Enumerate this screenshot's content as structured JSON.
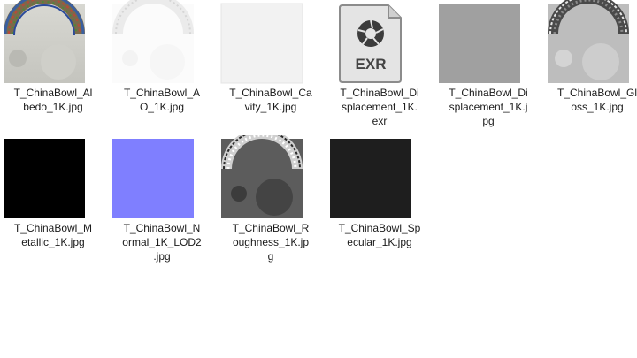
{
  "files": [
    {
      "name": "albedo",
      "label": "T_ChinaBowl_Al\nbedo_1K.jpg"
    },
    {
      "name": "ao",
      "label": "T_ChinaBowl_A\nO_1K.jpg"
    },
    {
      "name": "cavity",
      "label": "T_ChinaBowl_Ca\nvity_1K.jpg"
    },
    {
      "name": "displacement-exr",
      "label": "T_ChinaBowl_Di\nsplacement_1K.\nexr",
      "icon_text": "EXR"
    },
    {
      "name": "displacement-jpg",
      "label": "T_ChinaBowl_Di\nsplacement_1K.j\npg"
    },
    {
      "name": "gloss",
      "label": "T_ChinaBowl_Gl\noss_1K.jpg"
    },
    {
      "name": "metallic",
      "label": "T_ChinaBowl_M\netallic_1K.jpg"
    },
    {
      "name": "normal",
      "label": "T_ChinaBowl_N\normal_1K_LOD2\n.jpg"
    },
    {
      "name": "roughness",
      "label": "T_ChinaBowl_R\noughness_1K.jp\ng"
    },
    {
      "name": "specular",
      "label": "T_ChinaBowl_Sp\necular_1K.jpg"
    }
  ],
  "colors": {
    "metallic": "#000000",
    "normal": "#7f7fff",
    "specular": "#1e1e1e",
    "displacement": "#a0a0a0",
    "cavity": "#f2f2f2"
  }
}
